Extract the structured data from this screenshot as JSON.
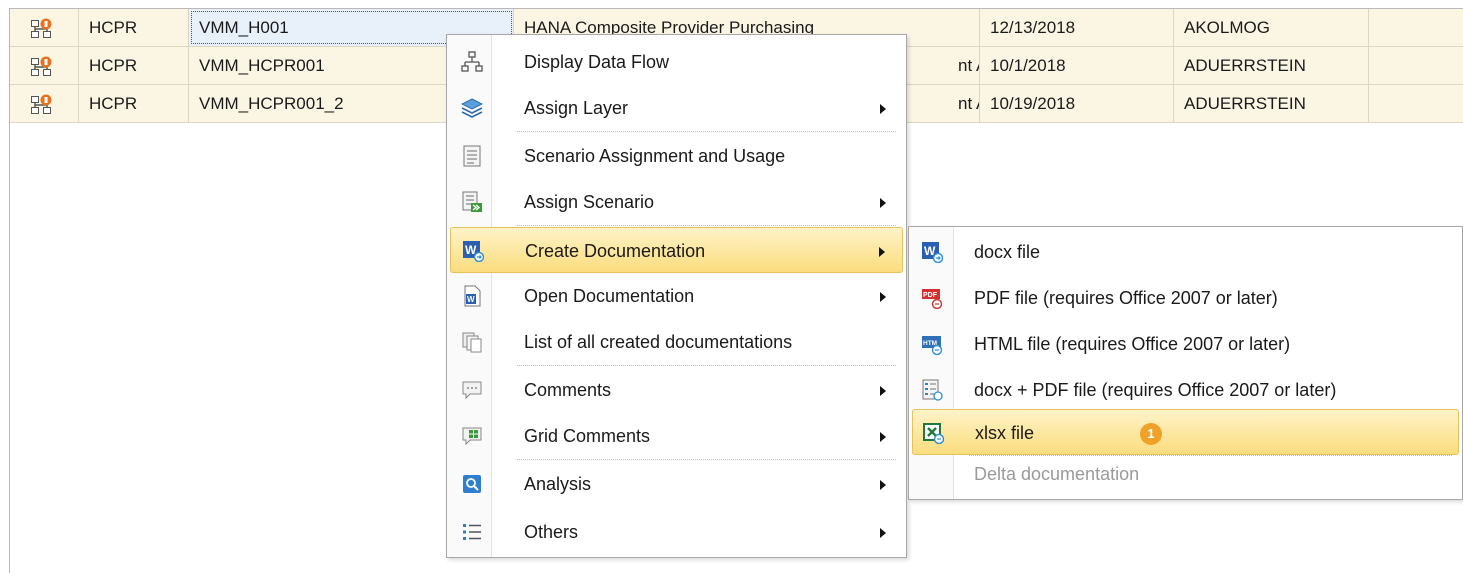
{
  "grid": {
    "rows": [
      {
        "type": "HCPR",
        "name": "VMM_H001",
        "description": "HANA Composite Provider Purchasing",
        "date": "12/13/2018",
        "user": "AKOLMOG"
      },
      {
        "type": "HCPR",
        "name": "VMM_HCPR001",
        "description": "nt Ass...",
        "date": "10/1/2018",
        "user": "ADUERRSTEIN"
      },
      {
        "type": "HCPR",
        "name": "VMM_HCPR001_2",
        "description": "nt Ass...",
        "date": "10/19/2018",
        "user": "ADUERRSTEIN"
      }
    ]
  },
  "context_menu": {
    "items": [
      {
        "label": "Display Data Flow",
        "icon": "data-flow-icon"
      },
      {
        "label": "Assign Layer",
        "icon": "layer-icon"
      },
      {
        "label": "Scenario Assignment and Usage",
        "icon": "document-list-icon"
      },
      {
        "label": "Assign Scenario",
        "icon": "assign-scenario-icon"
      },
      {
        "label": "Create Documentation",
        "icon": "word-doc-icon"
      },
      {
        "label": "Open Documentation",
        "icon": "open-doc-icon"
      },
      {
        "label": "List of all created documentations",
        "icon": "copy-docs-icon"
      },
      {
        "label": "Comments",
        "icon": "comment-icon"
      },
      {
        "label": "Grid Comments",
        "icon": "grid-comment-icon"
      },
      {
        "label": "Analysis",
        "icon": "analysis-icon"
      },
      {
        "label": "Others",
        "icon": "list-icon"
      }
    ]
  },
  "submenu": {
    "items": [
      {
        "label": "docx file",
        "icon": "docx-icon"
      },
      {
        "label": "PDF file (requires Office 2007 or later)",
        "icon": "pdf-icon"
      },
      {
        "label": "HTML file (requires Office 2007 or later)",
        "icon": "html-icon"
      },
      {
        "label": "docx + PDF file (requires Office 2007 or later)",
        "icon": "docx-pdf-icon"
      },
      {
        "label": "xlsx file",
        "icon": "excel-icon"
      },
      {
        "label": "Delta documentation"
      }
    ],
    "badge": "1"
  },
  "colors": {
    "highlight": "#fbdd7e",
    "row_bg": "#fbf6e4",
    "badge": "#f0a128"
  }
}
